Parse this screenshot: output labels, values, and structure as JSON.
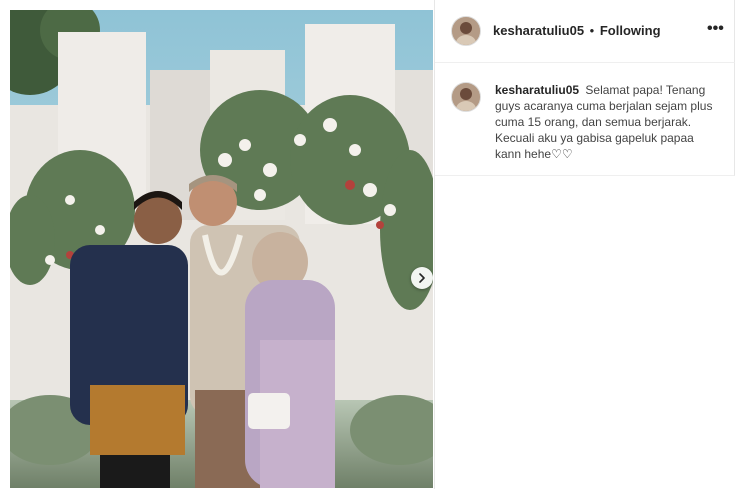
{
  "post": {
    "username": "kesharatuliu05",
    "separator": "•",
    "follow_status": "Following",
    "more_label": "•••",
    "caption": {
      "username": "kesharatuliu05",
      "text": "Selamat papa! Tenang guys acaranya cuma berjalan sejam plus cuma 15 orang, dan semua berjarak. Kecuali aku ya gabisa gapeluk papaa kann hehe",
      "emoji": "♡♡"
    },
    "carousel_next_icon": "chevron-right-icon"
  },
  "colors": {
    "text_primary": "#262626",
    "border": "#efefef",
    "sky": "#9ecad8"
  }
}
